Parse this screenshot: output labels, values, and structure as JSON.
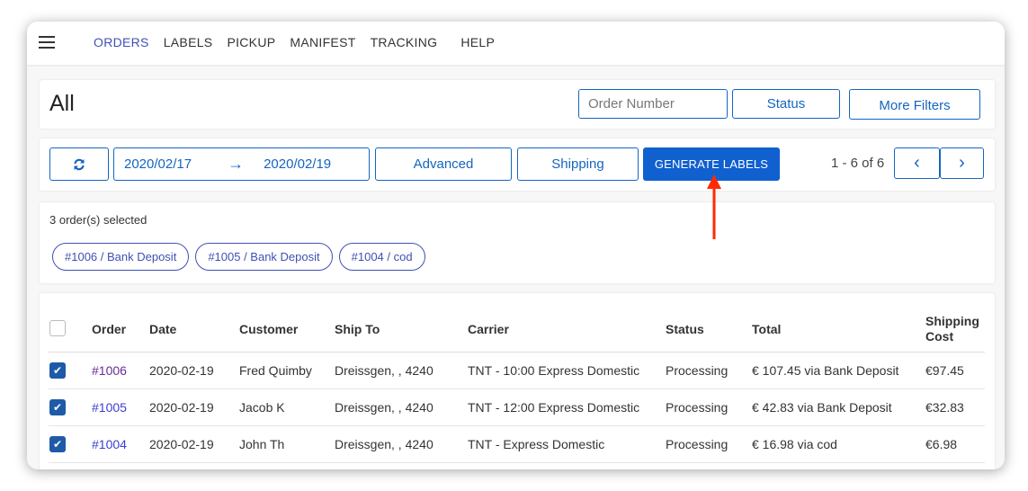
{
  "nav": {
    "menu_icon": "hamburger-menu-icon",
    "items": [
      {
        "label": "ORDERS",
        "active": true
      },
      {
        "label": "LABELS"
      },
      {
        "label": "PICKUP"
      },
      {
        "label": "MANIFEST"
      },
      {
        "label": "TRACKING"
      },
      {
        "label": "HELP"
      }
    ]
  },
  "header": {
    "title": "All",
    "search_placeholder": "Order Number",
    "search_icon": "search-icon",
    "status_label": "Status",
    "more_filters_label": "More Filters"
  },
  "toolbar": {
    "refresh_icon": "refresh-icon",
    "date_from": "2020/02/17",
    "date_arrow": "→",
    "date_to": "2020/02/19",
    "advanced_label": "Advanced",
    "shipping_label": "Shipping",
    "generate_labels_label": "GENERATE LABELS",
    "pager_text": "1 - 6 of 6",
    "prev_icon": "‹",
    "next_icon": "›"
  },
  "selection": {
    "text": "3 order(s) selected",
    "chips": [
      "#1006 / Bank Deposit",
      "#1005 / Bank Deposit",
      "#1004 / cod"
    ]
  },
  "table": {
    "headers": [
      "Order",
      "Date",
      "Customer",
      "Ship To",
      "Carrier",
      "Status",
      "Total",
      "Shipping Cost"
    ],
    "rows": [
      {
        "checked": true,
        "order": "#1006",
        "visited": true,
        "date": "2020-02-19",
        "customer": "Fred Quimby",
        "ship_to": "Dreissgen, , 4240",
        "carrier": "TNT - 10:00 Express Domestic",
        "status": "Processing",
        "total": "€ 107.45 via Bank Deposit",
        "shipping_cost": "€97.45"
      },
      {
        "checked": true,
        "order": "#1005",
        "visited": false,
        "date": "2020-02-19",
        "customer": "Jacob K",
        "ship_to": "Dreissgen, , 4240",
        "carrier": "TNT - 12:00 Express Domestic",
        "status": "Processing",
        "total": "€ 42.83 via Bank Deposit",
        "shipping_cost": "€32.83"
      },
      {
        "checked": true,
        "order": "#1004",
        "visited": false,
        "date": "2020-02-19",
        "customer": "John Th",
        "ship_to": "Dreissgen, , 4240",
        "carrier": "TNT - Express Domestic",
        "status": "Processing",
        "total": "€ 16.98 via cod",
        "shipping_cost": "€6.98"
      }
    ]
  },
  "colors": {
    "accent": "#1565c0",
    "primary_button": "#1060d0",
    "nav_active": "#3f51b5",
    "annotation_arrow": "#ff2a00"
  }
}
